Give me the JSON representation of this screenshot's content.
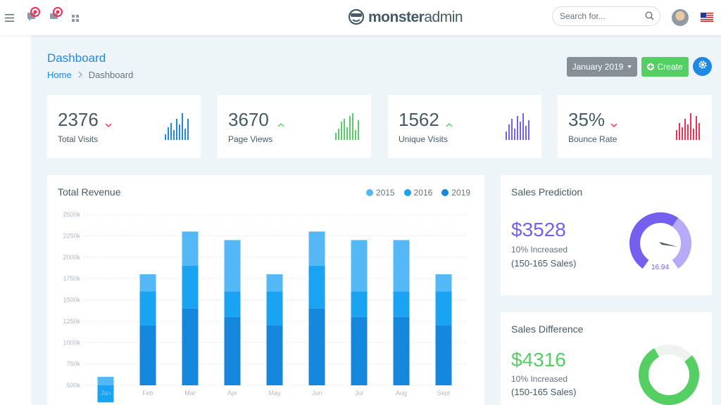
{
  "app": {
    "logo_bold": "monster",
    "logo_light": "admin"
  },
  "search": {
    "placeholder": "Search for..."
  },
  "header": {
    "title": "Dashboard",
    "breadcrumb": {
      "home": "Home",
      "current": "Dashboard"
    },
    "month_button": "January 2019",
    "create_button": "Create"
  },
  "stats": [
    {
      "value": "2376",
      "label": "Total Visits",
      "trend": "down",
      "color": "#1e88e5"
    },
    {
      "value": "3670",
      "label": "Page Views",
      "trend": "up",
      "color": "#55ce63"
    },
    {
      "value": "1562",
      "label": "Unique Visits",
      "trend": "up",
      "color": "#7460ee"
    },
    {
      "value": "35%",
      "label": "Bounce Rate",
      "trend": "down",
      "color": "#f62d51"
    }
  ],
  "revenue": {
    "title": "Total Revenue"
  },
  "chart_data": {
    "type": "bar",
    "stacked": true,
    "categories": [
      "Jan",
      "Feb",
      "Mar",
      "Apr",
      "May",
      "Jun",
      "Jul",
      "Aug",
      "Sept"
    ],
    "series": [
      {
        "name": "2015",
        "color": "#53b8f5",
        "values": [
          100,
          200,
          400,
          600,
          200,
          400,
          600,
          600,
          200
        ]
      },
      {
        "name": "2016",
        "color": "#1aa3f2",
        "values": [
          200,
          400,
          500,
          300,
          400,
          500,
          300,
          300,
          400
        ]
      },
      {
        "name": "2019",
        "color": "#1487dc",
        "values": [
          300,
          1200,
          1400,
          1300,
          1200,
          1400,
          1300,
          1300,
          1200
        ]
      }
    ],
    "y_ticks": [
      "500k",
      "750k",
      "1000k",
      "1250k",
      "1500k",
      "1750k",
      "2000k",
      "2250k",
      "2500k"
    ],
    "ylim": [
      500,
      2500
    ],
    "grid": true,
    "legend": "top-right"
  },
  "prediction": {
    "title": "Sales Prediction",
    "value": "$3528",
    "increase": "10% Increased",
    "sales": "(150-165 Sales)",
    "gauge_value": "16.94",
    "gauge_level": 0.85,
    "color": "#7460ee"
  },
  "difference": {
    "title": "Sales Difference",
    "value": "$4316",
    "increase": "10% Increased",
    "sales": "(150-165 Sales)",
    "donut_fraction": 0.78,
    "color": "#55ce63"
  },
  "colors": {
    "primary": "#1e88e5",
    "success": "#55ce63",
    "purple": "#7460ee",
    "danger": "#f62d51",
    "secondary": "#868e96"
  }
}
